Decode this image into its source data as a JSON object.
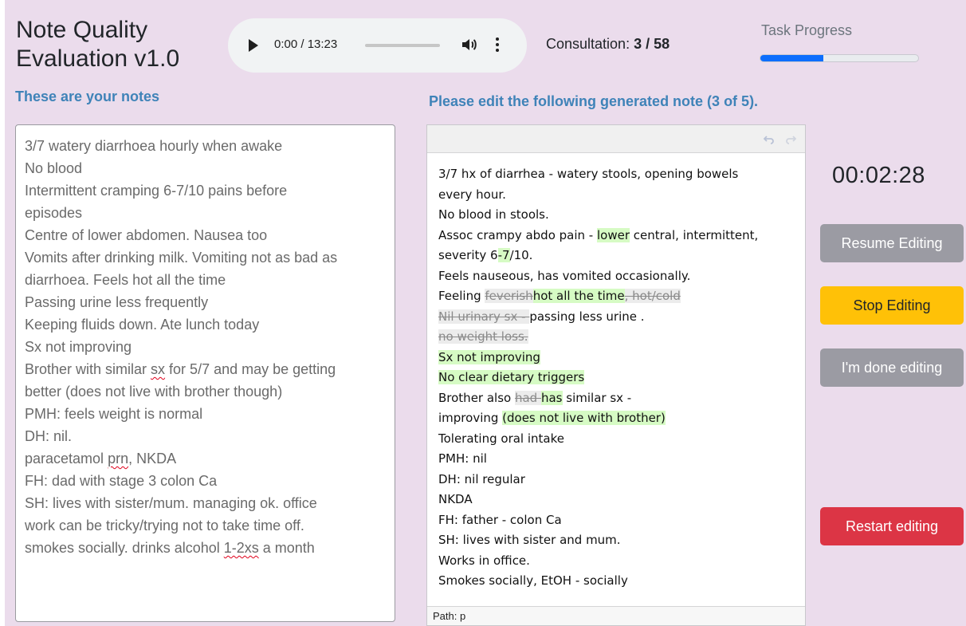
{
  "app": {
    "title": "Note Quality Evaluation v1.0"
  },
  "audio": {
    "time": "0:00 / 13:23"
  },
  "consultation": {
    "label": "Consultation: ",
    "value": "3 / 58"
  },
  "progress": {
    "label": "Task Progress",
    "fraction": 0.4
  },
  "left_panel": {
    "heading": "These are your notes",
    "lines": [
      [
        {
          "t": "3/7 watery diarrhoea hourly when awake"
        }
      ],
      [
        {
          "t": "No blood"
        }
      ],
      [
        {
          "t": "Intermittent cramping 6-7/10 pains before"
        }
      ],
      [
        {
          "t": "episodes"
        }
      ],
      [
        {
          "t": "Centre of lower abdomen. Nausea too"
        }
      ],
      [
        {
          "t": "Vomits after drinking milk. Vomiting not as bad as"
        }
      ],
      [
        {
          "t": "diarrhoea. Feels hot all the time"
        }
      ],
      [
        {
          "t": "Passing urine less frequently"
        }
      ],
      [
        {
          "t": "Keeping fluids down. Ate lunch today"
        }
      ],
      [
        {
          "t": "Sx not improving"
        }
      ],
      [
        {
          "t": "Brother with similar "
        },
        {
          "t": "sx",
          "s": "spell"
        },
        {
          "t": " for 5/7 and may be getting"
        }
      ],
      [
        {
          "t": "better (does not live with brother though)"
        }
      ],
      [
        {
          "t": "PMH: feels weight is normal"
        }
      ],
      [
        {
          "t": "DH: nil."
        }
      ],
      [
        {
          "t": "paracetamol "
        },
        {
          "t": "prn",
          "s": "spell"
        },
        {
          "t": ", NKDA"
        }
      ],
      [
        {
          "t": "FH: dad with stage 3 colon Ca"
        }
      ],
      [
        {
          "t": "SH: lives with sister/mum. managing ok. office"
        }
      ],
      [
        {
          "t": "work can be tricky/trying not to take time off."
        }
      ],
      [
        {
          "t": "smokes socially. drinks alcohol "
        },
        {
          "t": "1-2xs",
          "s": "spell"
        },
        {
          "t": " a month"
        }
      ]
    ]
  },
  "right_panel": {
    "heading": "Please edit the following generated note (3 of 5).",
    "lines": [
      [
        {
          "t": "3/7 hx of diarrhea - watery stools, opening bowels"
        }
      ],
      [
        {
          "t": "every hour."
        }
      ],
      [
        {
          "t": "No blood in stools."
        }
      ],
      [
        {
          "t": "Assoc crampy abdo pain - "
        },
        {
          "t": "lower",
          "s": "ins"
        },
        {
          "t": " central, intermittent,"
        }
      ],
      [
        {
          "t": "severity 6"
        },
        {
          "t": "-7",
          "s": "ins"
        },
        {
          "t": "/10."
        }
      ],
      [
        {
          "t": "Feels nauseous, has vomited occasionally."
        }
      ],
      [
        {
          "t": "Feeling "
        },
        {
          "t": "feverish",
          "s": "del"
        },
        {
          "t": "hot all the time",
          "s": "ins"
        },
        {
          "t": ", hot/cold",
          "s": "del"
        }
      ],
      [
        {
          "t": "Nil urinary sx - ",
          "s": "del"
        },
        {
          "t": "passing less urine ."
        }
      ],
      [
        {
          "t": "no weight loss.",
          "s": "del"
        }
      ],
      [
        {
          "t": "Sx not improving",
          "s": "ins"
        }
      ],
      [
        {
          "t": "No clear dietary triggers",
          "s": "ins"
        }
      ],
      [
        {
          "t": "Brother also "
        },
        {
          "t": "had ",
          "s": "del"
        },
        {
          "t": "has",
          "s": "ins"
        },
        {
          "t": " similar sx -"
        }
      ],
      [
        {
          "t": "improving "
        },
        {
          "t": "(does not live with brother)",
          "s": "ins"
        }
      ],
      [
        {
          "t": "Tolerating oral intake"
        }
      ],
      [
        {
          "t": "PMH: nil"
        }
      ],
      [
        {
          "t": "DH: nil regular"
        }
      ],
      [
        {
          "t": "NKDA"
        }
      ],
      [
        {
          "t": "FH: father - colon Ca"
        }
      ],
      [
        {
          "t": "SH: lives with sister and mum."
        }
      ],
      [
        {
          "t": "Works in office."
        }
      ],
      [
        {
          "t": "Smokes socially, EtOH - socially"
        }
      ]
    ],
    "status_path": "Path: p"
  },
  "timer": "00:02:28",
  "buttons": {
    "resume": "Resume Editing",
    "stop": "Stop Editing",
    "done": "I'm done editing",
    "restart": "Restart editing"
  },
  "colors": {
    "background": "#ebdcec",
    "heading": "#3f83b8",
    "insert_highlight": "#d6fbc4",
    "stop_button": "#ffc107",
    "restart_button": "#dc3545",
    "disabled_button": "#9b9ba3",
    "progress_fill": "#0d6efd"
  },
  "icons": [
    "play-icon",
    "volume-icon",
    "more-options-icon",
    "undo-icon",
    "redo-icon"
  ]
}
